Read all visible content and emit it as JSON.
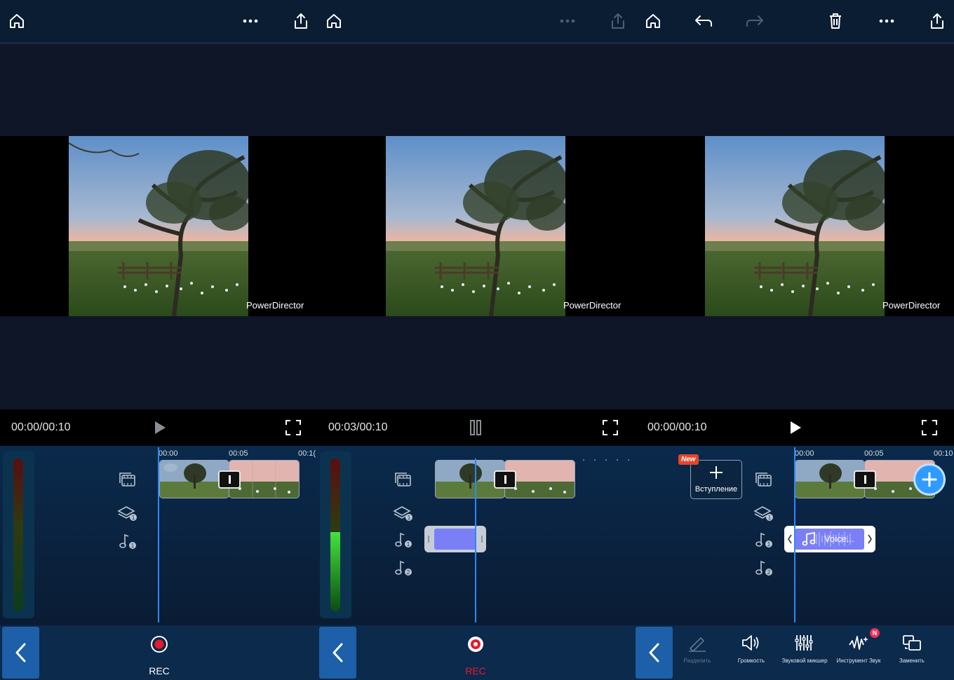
{
  "panels": [
    {
      "watermark": "PowerDirector",
      "timecode": "00:00/00:10",
      "ruler": [
        "00:00",
        "00:05",
        "00:1("
      ],
      "rec_label": "REC",
      "rec_color": "#ffffff",
      "level_fraction": 0.0
    },
    {
      "watermark": "PowerDirector",
      "timecode": "00:03/00:10",
      "ruler": [],
      "rec_label": "REC",
      "rec_color": "#e8192c",
      "level_fraction": 0.52
    },
    {
      "watermark": "PowerDirector",
      "timecode": "00:00/00:10",
      "ruler": [
        "00:00",
        "00:05",
        "00:10"
      ],
      "new_badge": "New",
      "intro_label": "Вступление",
      "voice_clip_label": "Voice...",
      "tools": [
        {
          "label": "Разделить",
          "icon": "split-icon",
          "enabled": false
        },
        {
          "label": "Громкость",
          "icon": "volume-icon",
          "enabled": true
        },
        {
          "label": "Звуковой микшер",
          "icon": "mixer-icon",
          "enabled": true
        },
        {
          "label": "Инструмент Звук",
          "icon": "audio-tool-icon",
          "enabled": true,
          "badge": "N"
        },
        {
          "label": "Заменить",
          "icon": "replace-icon",
          "enabled": true
        }
      ]
    }
  ],
  "colors": {
    "accent": "#2f86ff",
    "rec_red": "#e8192c",
    "voice_clip": "#7b7ff5",
    "bar_bg": "#0b2a4c"
  }
}
